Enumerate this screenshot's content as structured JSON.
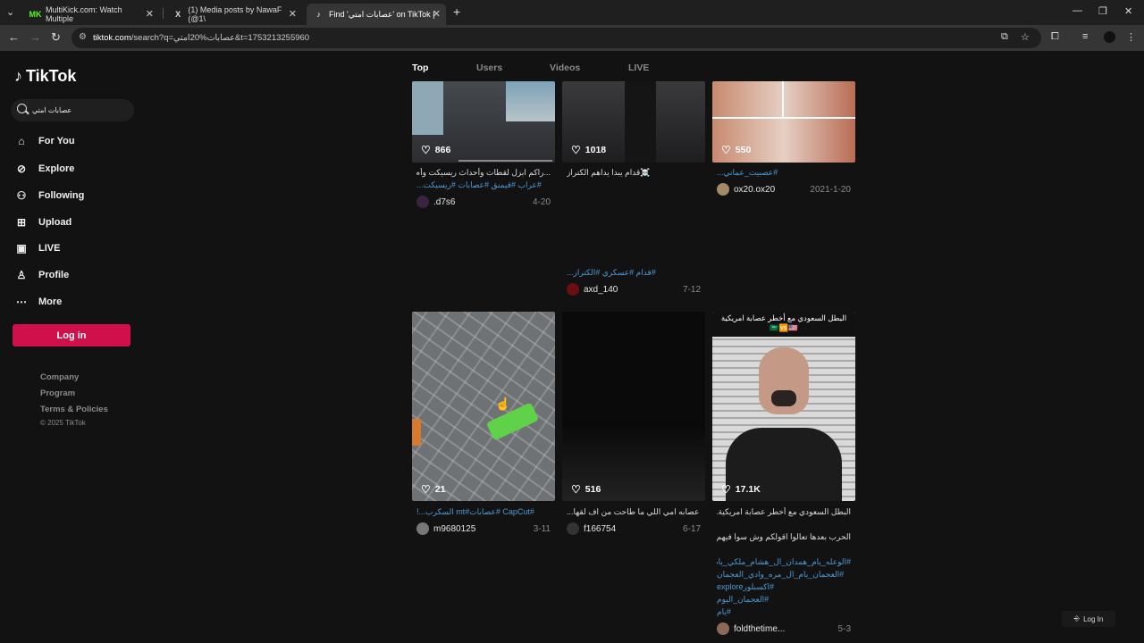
{
  "browser": {
    "tabs": [
      {
        "title": "MultiKick.com: Watch Multiple",
        "favicon": "MK"
      },
      {
        "title": "(1) Media posts by NawaF (@1\\",
        "favicon": "X"
      },
      {
        "title": "Find 'عصابات امتي' on TikTok |",
        "favicon": "♪"
      }
    ],
    "new_tab": "+",
    "url_host": "tiktok.com",
    "url_path": "/search?q=عصابات%20امتي&t=1753213255960"
  },
  "sidebar": {
    "logo": "TikTok",
    "search_value": "عصابات امتي",
    "nav": [
      {
        "label": "For You",
        "icon": "home-icon"
      },
      {
        "label": "Explore",
        "icon": "compass-icon"
      },
      {
        "label": "Following",
        "icon": "user-follow-icon"
      },
      {
        "label": "Upload",
        "icon": "plus-square-icon"
      },
      {
        "label": "LIVE",
        "icon": "live-tv-icon"
      },
      {
        "label": "Profile",
        "icon": "person-icon"
      },
      {
        "label": "More",
        "icon": "ellipsis-icon"
      }
    ],
    "login_label": "Log in",
    "footer_links": [
      "Company",
      "Program",
      "Terms & Policies"
    ],
    "copyright": "© 2025 TikTok"
  },
  "search_tabs": [
    "Top",
    "Users",
    "Videos",
    "LIVE"
  ],
  "videos": [
    {
      "likes": "866",
      "caption": "...راكم ابزل لقطات وأحداث ريسيكت وأم تي",
      "tags": "#عراب #قيمنق #عصابات #ريسيكت...",
      "author": ".d7s6",
      "date": "4-20"
    },
    {
      "likes": "1018",
      "caption": "☠️قدام يبدا يداهم الكتراز",
      "tags": "#قدام #عسكري #الكتراز...",
      "author": "axd_140",
      "date": "7-12"
    },
    {
      "likes": "550",
      "caption": "",
      "tags": "#عصبيت_عماني...",
      "author": "ox20.ox20",
      "date": "2021-1-20"
    },
    {
      "likes": "21",
      "caption": "",
      "tags": "#CapCut #عصابات#mt السكرب...!",
      "author": "m9680125",
      "date": "3-11"
    },
    {
      "likes": "516",
      "caption": "عصابه امي اللي ما طاحت من اف لقها...",
      "tags": "",
      "author": "f166754",
      "date": "6-17"
    },
    {
      "likes": "17.1K",
      "caption": "البطل السعودي مع أخطر عصابة امريكية...",
      "caption2": "الحرب بعدها تعالوا اقولكم وش سوا فيهم ...",
      "tags_lines": [
        "#الوعله_يام_همدان_ال_هشام_ملكي_يام",
        "#العجمان_يام_ال_مره_وادي_العجمان",
        "#اكسبلورexplore",
        "#العجمان_اليوم",
        "#يام"
      ],
      "overlay": "البطل السعودي مع أخطر عصابة امريكية 🇸🇦🆚🇺🇸",
      "author": "foldthetime...",
      "date": "5-3"
    }
  ],
  "float_login": "Log In"
}
